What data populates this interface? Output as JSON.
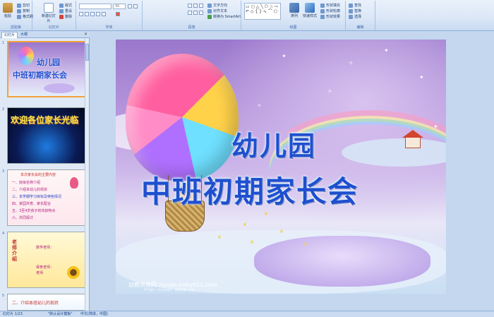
{
  "ribbon": {
    "clipboard": {
      "paste_label": "粘贴",
      "cut_label": "剪切",
      "copy_label": "复制",
      "format_label": "格式刷",
      "group_label": "剪贴板"
    },
    "slides": {
      "new_slide_label": "新建幻灯片",
      "layout_label": "版式",
      "reset_label": "重设",
      "delete_label": "删除",
      "group_label": "幻灯片"
    },
    "font": {
      "font_name": "",
      "font_size": "96",
      "group_label": "字体"
    },
    "paragraph": {
      "direction_label": "文字方向",
      "align_label": "对齐文本",
      "smartart_label": "转换为 SmartArt",
      "group_label": "段落"
    },
    "drawing": {
      "arrange_label": "排列",
      "quick_styles_label": "快速样式",
      "fill_label": "形状填充",
      "outline_label": "形状轮廓",
      "effects_label": "形状效果",
      "group_label": "绘图"
    },
    "editing": {
      "find_label": "查找",
      "replace_label": "替换",
      "select_label": "选择",
      "group_label": "编辑"
    }
  },
  "panel": {
    "tabs": [
      "幻灯片",
      "大纲"
    ],
    "close_icon": "close-icon",
    "thumbnails": [
      {
        "num": "1",
        "title": "幼儿园",
        "subtitle": "中班初期家长会"
      },
      {
        "num": "2",
        "title": "欢迎各位家长光临"
      },
      {
        "num": "3",
        "title": "本次家长会的主要内容",
        "lines": [
          "一、班级名称介绍",
          "二、介绍本幼儿的现状",
          "三、本学期学习目标及特色情况",
          "四、家园共育、家长配合",
          "五、3至4岁孩子的年龄特点",
          "六、共同探讨"
        ]
      },
      {
        "num": "4",
        "title": "老师介绍",
        "lines": [
          "数学老师：",
          "保育老师：",
          "老师"
        ]
      },
      {
        "num": "5",
        "title": "二、介绍本班幼儿的现状"
      }
    ]
  },
  "slide": {
    "title": "幼儿园",
    "subtitle": "中班初期家长会",
    "watermark": "幼教资源网 ziyuan.baby611.com",
    "watermark_sub": "PPT课件 · FLASH课件 · 教案音像 · 试卷"
  },
  "status": {
    "slide_info": "幻灯片 1/23",
    "theme": "\"默认设计模板\"",
    "language": "中文(简体，中国)"
  }
}
